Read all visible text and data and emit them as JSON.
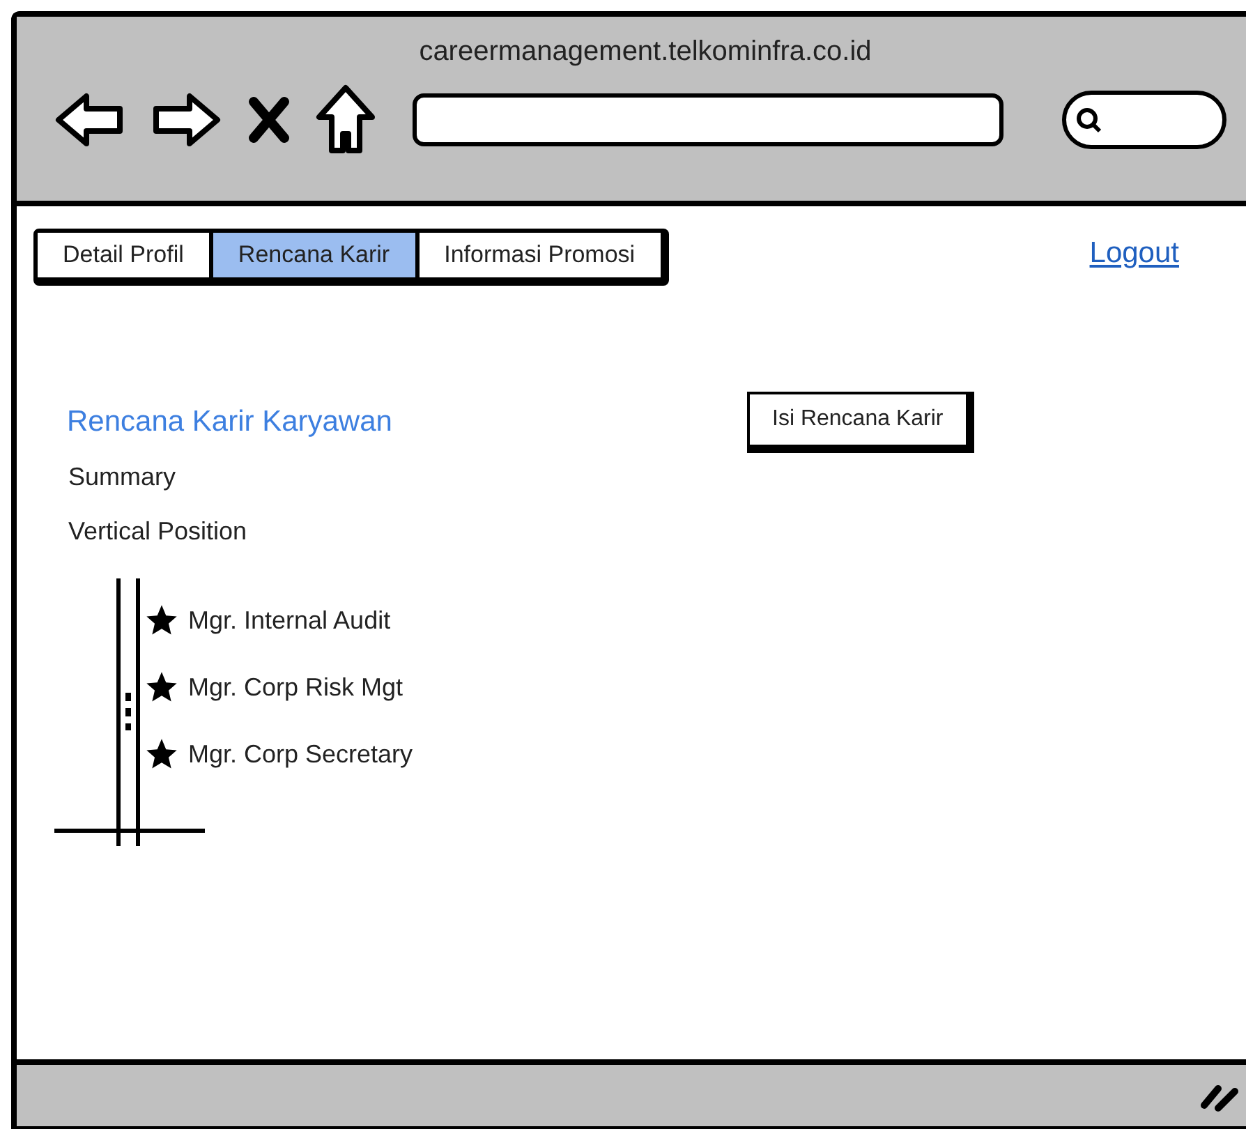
{
  "browser": {
    "url": "careermanagement.telkominfra.co.id"
  },
  "tabs": [
    {
      "label": "Detail Profil",
      "selected": false
    },
    {
      "label": "Rencana Karir",
      "selected": true
    },
    {
      "label": "Informasi Promosi",
      "selected": false
    }
  ],
  "logout": "Logout",
  "heading": "Rencana Karir Karyawan",
  "action_button": "Isi Rencana Karir",
  "summary": "Summary",
  "vertical_position": {
    "label": "Vertical Position",
    "positions": [
      {
        "title": "Mgr. Internal Audit"
      },
      {
        "title": "Mgr. Corp Risk Mgt"
      },
      {
        "title": "Mgr. Corp Secretary"
      }
    ]
  }
}
